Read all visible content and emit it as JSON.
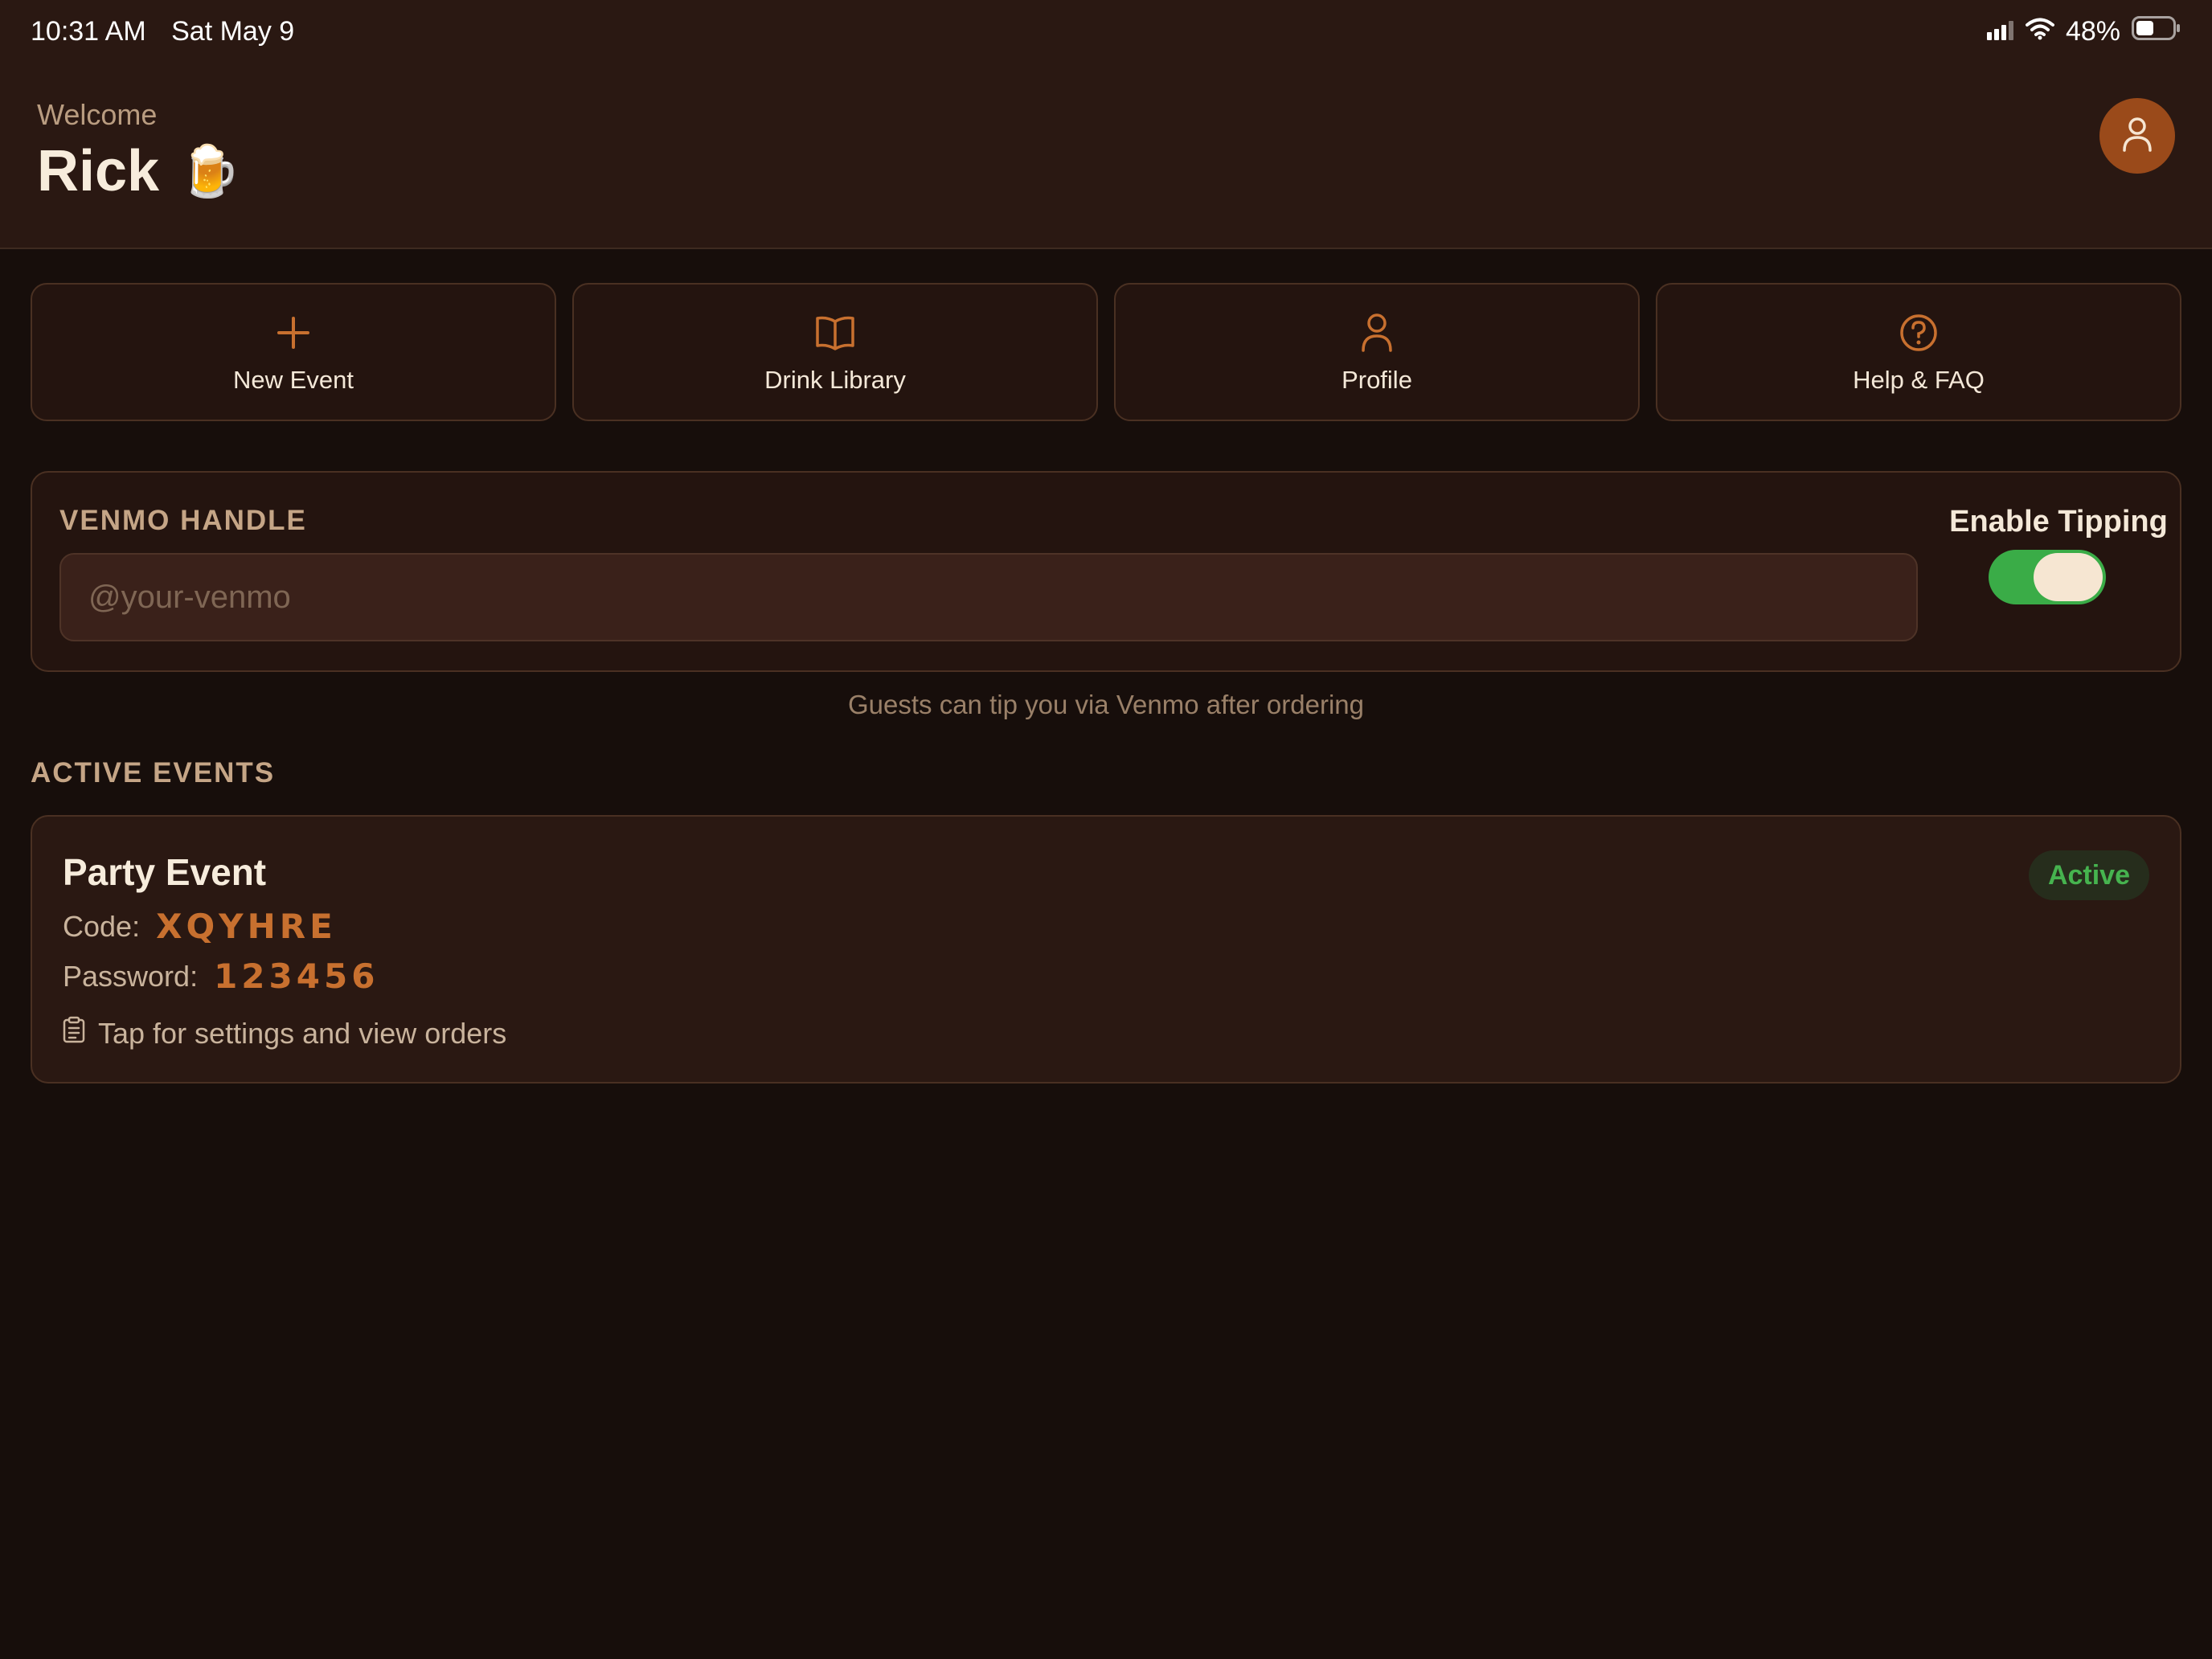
{
  "status_bar": {
    "time": "10:31 AM",
    "date": "Sat May 9",
    "battery": "48%",
    "battery_level": 0.48,
    "icons": [
      "signal-icon",
      "wifi-icon",
      "battery-icon"
    ]
  },
  "header": {
    "welcome": "Welcome",
    "user_name": "Rick",
    "user_emoji": "🍺",
    "avatar_icon": "person-icon"
  },
  "quick_actions": [
    {
      "label": "New Event",
      "icon": "plus-icon"
    },
    {
      "label": "Drink Library",
      "icon": "book-icon"
    },
    {
      "label": "Profile",
      "icon": "person-icon"
    },
    {
      "label": "Help & FAQ",
      "icon": "question-circle-icon"
    }
  ],
  "venmo": {
    "label": "VENMO HANDLE",
    "value": "",
    "placeholder": "@your-venmo",
    "tipping_label": "Enable Tipping",
    "tipping_enabled": true,
    "note": "Guests can tip you via Venmo after ordering"
  },
  "active_events": {
    "title": "ACTIVE EVENTS",
    "events": [
      {
        "name": "Party Event",
        "code_label": "Code:",
        "code": "XQYHRE",
        "password_label": "Password:",
        "password": "123456",
        "status": "Active",
        "hint": "Tap for settings and view orders",
        "hint_icon": "clipboard-icon"
      }
    ]
  },
  "colors": {
    "background": "#170e0b",
    "header": "#2a1812",
    "card": "#24140f",
    "accent": "#c8702f",
    "avatar": "#9a4a1a",
    "toggle_on": "#3aac47",
    "active_green": "#46b34f",
    "muted_label": "#c5a586"
  }
}
